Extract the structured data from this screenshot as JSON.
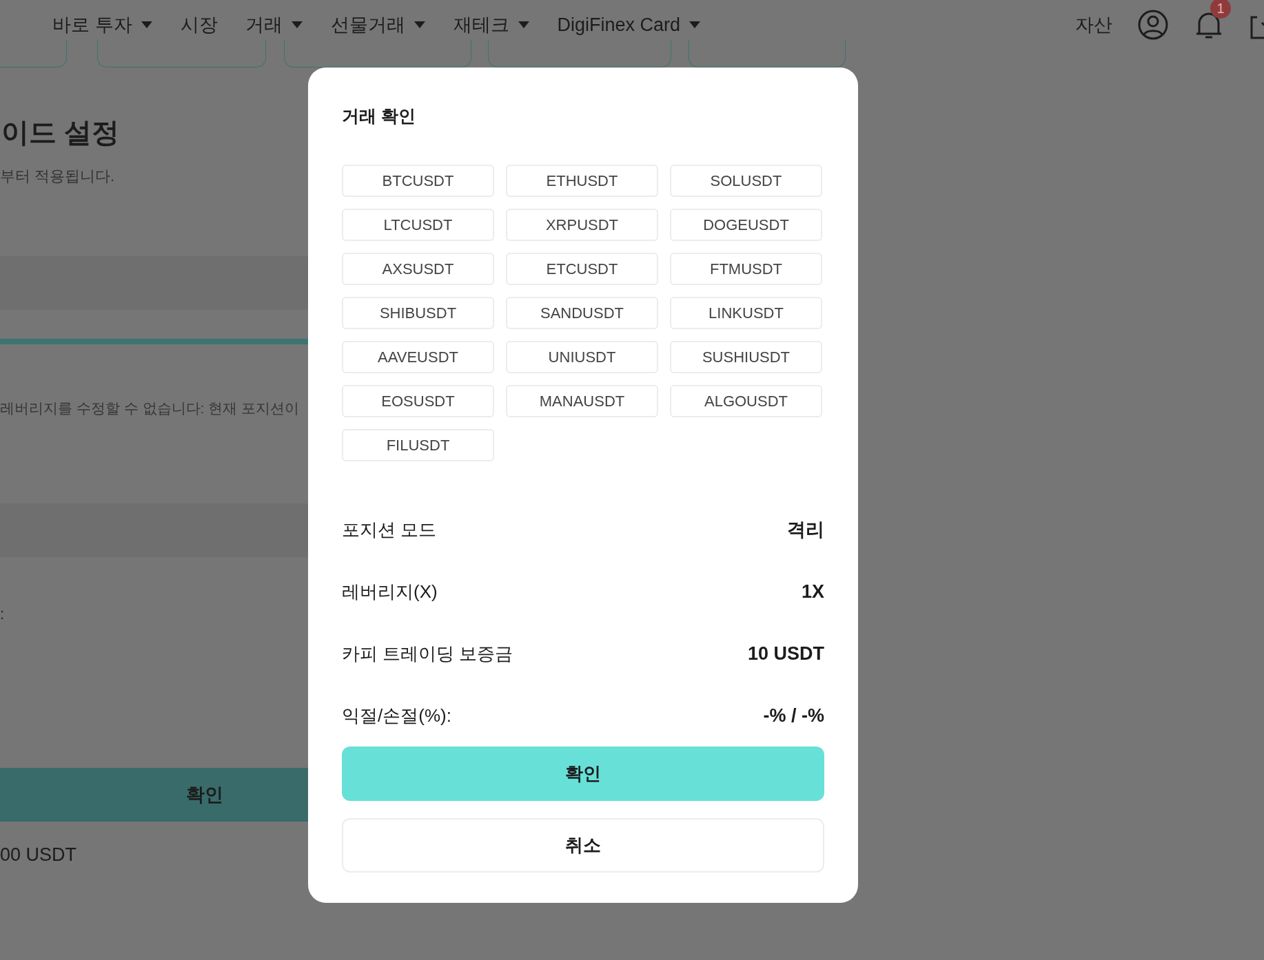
{
  "nav": {
    "items": [
      {
        "label": "바로 투자",
        "dropdown": true
      },
      {
        "label": "시장",
        "dropdown": false
      },
      {
        "label": "거래",
        "dropdown": true
      },
      {
        "label": "선물거래",
        "dropdown": true
      },
      {
        "label": "재테크",
        "dropdown": true
      },
      {
        "label": "DigiFinex Card",
        "dropdown": true
      }
    ],
    "assets": "자산",
    "notification_count": "1"
  },
  "background": {
    "title": "이드 설정",
    "subtitle": "부터 적용됩니다.",
    "notice": "레버리지를 수정할 수 없습니다: 현재 포지션이",
    "colon": ":",
    "confirm_button": "확인",
    "amount": "00 USDT"
  },
  "modal": {
    "title": "거래 확인",
    "pairs": [
      "BTCUSDT",
      "ETHUSDT",
      "SOLUSDT",
      "LTCUSDT",
      "XRPUSDT",
      "DOGEUSDT",
      "AXSUSDT",
      "ETCUSDT",
      "FTMUSDT",
      "SHIBUSDT",
      "SANDUSDT",
      "LINKUSDT",
      "AAVEUSDT",
      "UNIUSDT",
      "SUSHIUSDT",
      "EOSUSDT",
      "MANAUSDT",
      "ALGOUSDT",
      "FILUSDT"
    ],
    "details": [
      {
        "label": "포지션 모드",
        "value": "격리"
      },
      {
        "label": "레버리지(X)",
        "value": "1X"
      },
      {
        "label": "카피 트레이딩 보증금",
        "value": "10 USDT"
      },
      {
        "label": "익절/손절(%):",
        "value": "-% / -%"
      }
    ],
    "confirm_button": "확인",
    "cancel_button": "취소"
  }
}
